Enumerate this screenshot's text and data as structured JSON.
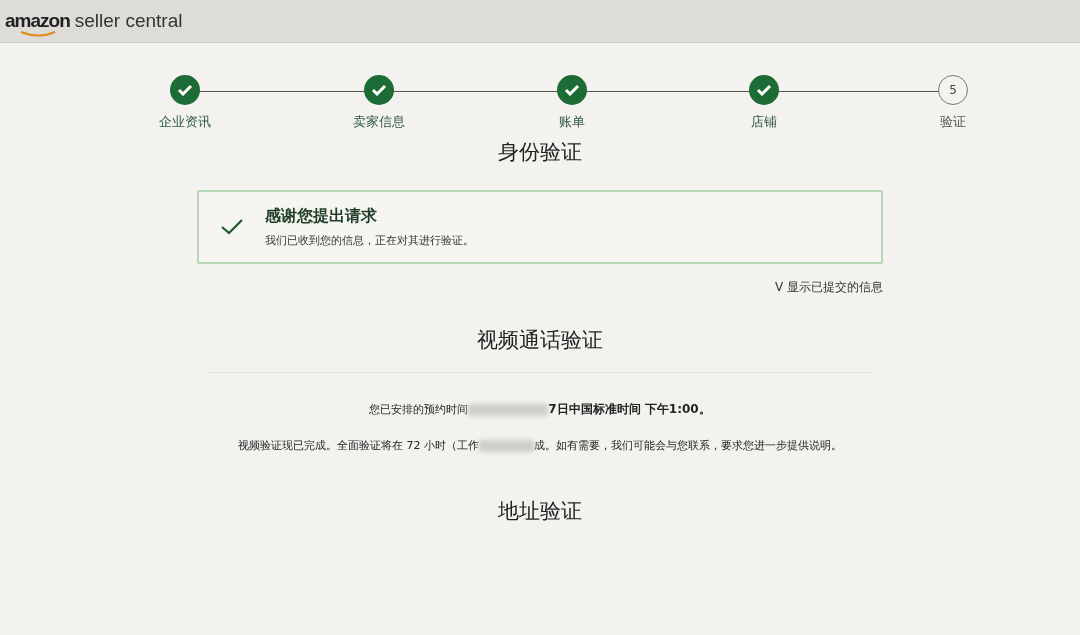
{
  "header": {
    "logo_brand": "amazon",
    "logo_product": "seller central"
  },
  "steps": [
    {
      "label": "企业资讯",
      "done": true
    },
    {
      "label": "卖家信息",
      "done": true
    },
    {
      "label": "账单",
      "done": true
    },
    {
      "label": "店铺",
      "done": true
    },
    {
      "label": "验证",
      "done": false,
      "number": "5"
    }
  ],
  "identity": {
    "title": "身份验证",
    "alert": {
      "title": "感谢您提出请求",
      "message": "我们已收到您的信息，正在对其进行验证。"
    },
    "toggle": {
      "caret": "V",
      "label": "显示已提交的信息"
    }
  },
  "video": {
    "title": "视频通话验证",
    "appointment": {
      "before": "您已安排的预约时间",
      "after": "7日中国标准时间 下午1:00。"
    },
    "status": {
      "before": "视频验证现已完成。全面验证将在 72 小时（工作",
      "after": "成。如有需要，我们可能会与您联系，要求您进一步提供说明。"
    }
  },
  "address": {
    "title": "地址验证"
  }
}
